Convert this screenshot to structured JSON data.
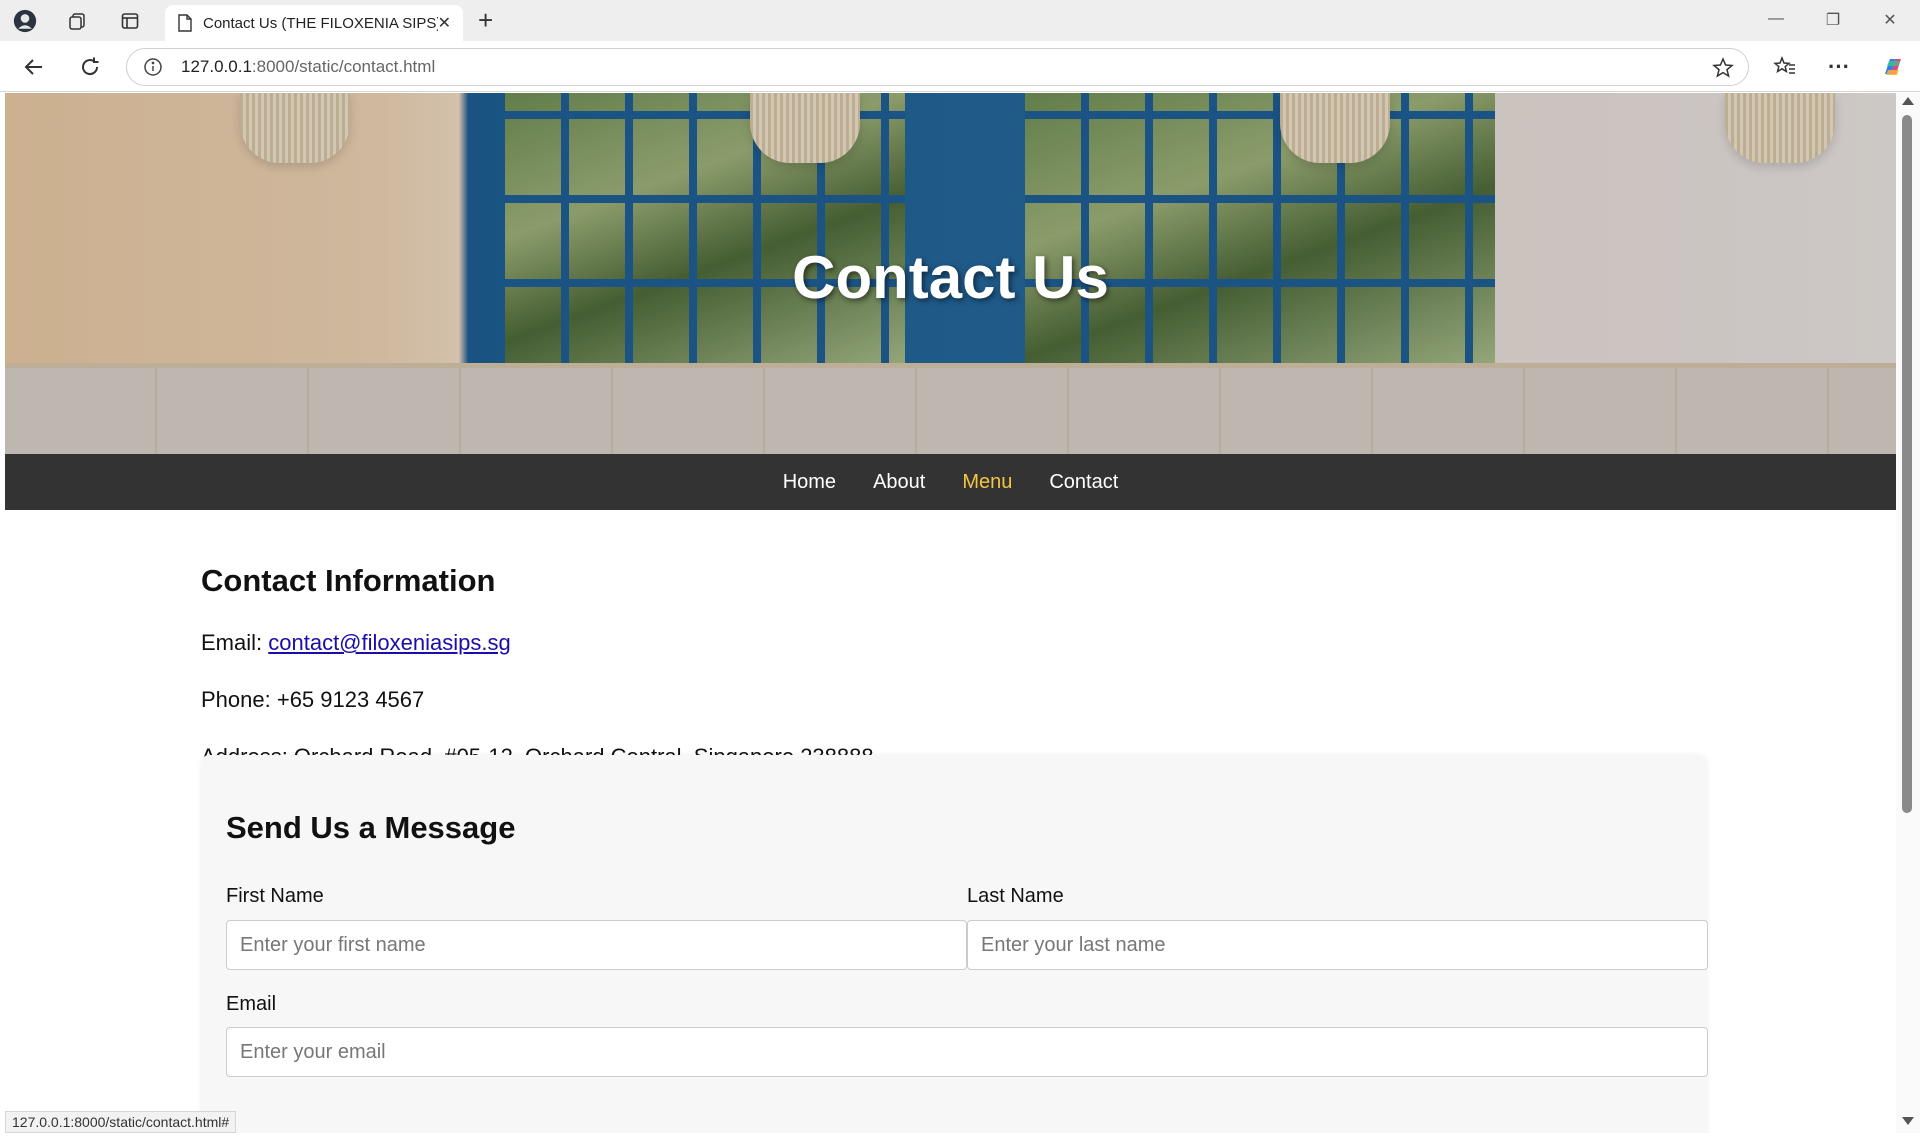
{
  "browser": {
    "tab_title": "Contact Us (THE FILOXENIA SIPS)",
    "url_host": "127.0.0.1",
    "url_rest": ":8000/static/contact.html",
    "status_url": "127.0.0.1:8000/static/contact.html#"
  },
  "hero": {
    "title": "Contact Us"
  },
  "nav": {
    "items": [
      {
        "label": "Home"
      },
      {
        "label": "About"
      },
      {
        "label": "Menu"
      },
      {
        "label": "Contact"
      }
    ],
    "active_color": "#f4c542"
  },
  "contact": {
    "heading": "Contact Information",
    "email_label": "Email:",
    "email": "contact@filoxeniasips.sg",
    "phone": "Phone: +65 9123 4567",
    "address": "Address: Orchard Road, #05-12, Orchard Central, Singapore 238888"
  },
  "form": {
    "heading": "Send Us a Message",
    "first_name_label": "First Name",
    "first_name_placeholder": "Enter your first name",
    "last_name_label": "Last Name",
    "last_name_placeholder": "Enter your last name",
    "email_label": "Email",
    "email_placeholder": "Enter your email"
  }
}
